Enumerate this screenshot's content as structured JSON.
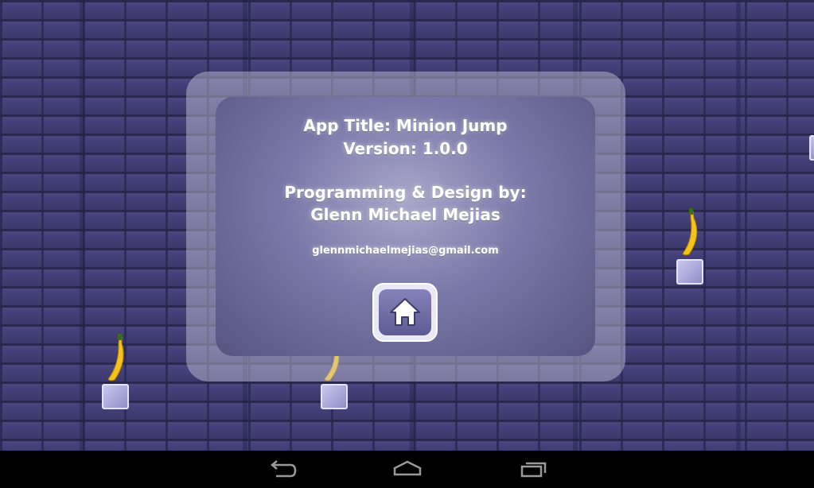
{
  "about": {
    "title_line": "App Title: Minion Jump",
    "version_line": "Version: 1.0.0",
    "credit_heading": "Programming & Design by:",
    "credit_name": "Glenn Michael Mejias",
    "email": "glennmichaelmejias@gmail.com"
  },
  "icons": {
    "home": "home-icon",
    "nav_back": "back-icon",
    "nav_home": "home-nav-icon",
    "nav_recents": "recents-icon"
  },
  "colors": {
    "brick": "#3a3868",
    "panel": "#7a78a8",
    "navbar": "#000000"
  }
}
